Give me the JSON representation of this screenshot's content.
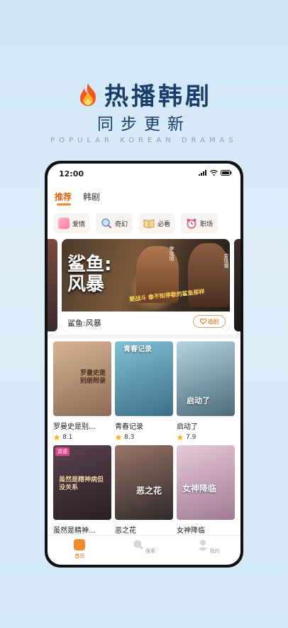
{
  "promo": {
    "headline": "热播韩剧",
    "subhead": "同步更新",
    "english": "POPULAR KOREAN DRAMAS"
  },
  "status": {
    "time": "12:00"
  },
  "tabs": [
    {
      "label": "推荐",
      "active": true
    },
    {
      "label": "韩剧",
      "active": false
    }
  ],
  "categories": [
    {
      "label": "爱情",
      "icon": "love-book-icon"
    },
    {
      "label": "奇幻",
      "icon": "magnifier-icon"
    },
    {
      "label": "必看",
      "icon": "book-icon"
    },
    {
      "label": "职场",
      "icon": "alarm-clock-icon"
    }
  ],
  "banner": {
    "title_line1": "鲨鱼:",
    "title_line2": "风暴",
    "slogan": "要战斗 像不知停歇的鲨鱼那样",
    "actor1": "李玹旭",
    "actor2": "金玟锡",
    "caption": "鲨鱼:风暴",
    "follow_label": "追剧"
  },
  "dramas": [
    {
      "title": "罗曼史是别...",
      "rating": "8.1",
      "poster_text": "罗曼史是别册附录",
      "colors": [
        "#c9a27e",
        "#8b6b55"
      ]
    },
    {
      "title": "青春记录",
      "rating": "8.3",
      "poster_text": "青春记录",
      "colors": [
        "#6fb3cf",
        "#3d6f86"
      ]
    },
    {
      "title": "启动了",
      "rating": "7.9",
      "poster_text": "启动了",
      "colors": [
        "#9cc2d8",
        "#4b6a7a"
      ]
    },
    {
      "title": "虽然是精神...",
      "rating": "",
      "poster_text": "虽然是精神病但没关系",
      "badge": "双语",
      "colors": [
        "#4f3a43",
        "#2a1e22"
      ]
    },
    {
      "title": "恶之花",
      "rating": "",
      "poster_text": "恶之花",
      "colors": [
        "#8c6a5f",
        "#2e2a2b"
      ]
    },
    {
      "title": "女神降临",
      "rating": "",
      "poster_text": "女神降临",
      "colors": [
        "#d7b6c8",
        "#a07b93"
      ]
    }
  ],
  "nav": [
    {
      "label": "首页",
      "icon": "home-icon",
      "active": true
    },
    {
      "label": "搜索",
      "icon": "search-icon",
      "active": false
    },
    {
      "label": "我的",
      "icon": "profile-icon",
      "active": false
    }
  ],
  "colors": {
    "accent": "#e8630d",
    "headline": "#1c3d6b"
  }
}
